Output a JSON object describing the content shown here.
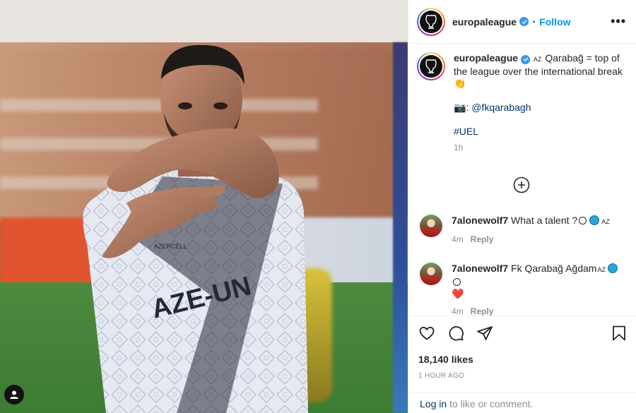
{
  "post": {
    "username": "europaleague",
    "follow_label": "Follow",
    "separator": "•",
    "more_label": "•••"
  },
  "caption": {
    "username": "europaleague",
    "flag": "AZ",
    "text_1": " Qarabağ = top of the league over the international break ",
    "clap_emoji": "👏",
    "camera_emoji": "📷",
    "credit_prefix": ": ",
    "credit_handle": "@fkqarabagh",
    "hashtag": "#UEL",
    "time": "1h"
  },
  "comments": [
    {
      "username": "7alonewolf7",
      "text": " What a talent ?",
      "flag": "AZ",
      "time": "4m",
      "reply_label": "Reply"
    },
    {
      "username": "7alonewolf7",
      "text": " Fk Qarabağ Ağdam",
      "flag": "AZ",
      "heart": "❤️",
      "time": "4m",
      "reply_label": "Reply"
    }
  ],
  "stats": {
    "likes": "18,140 likes",
    "posted": "1 HOUR AGO"
  },
  "login": {
    "link_text": "Log in",
    "suffix": " to like or comment."
  },
  "media": {
    "shirt_sponsor": "AZERCELL",
    "shirt_text": "AZE-UN"
  },
  "colors": {
    "accent_blue": "#0095f6",
    "link_dark": "#00376b",
    "verified": "#3897f0",
    "muted": "#8e8e8e"
  }
}
